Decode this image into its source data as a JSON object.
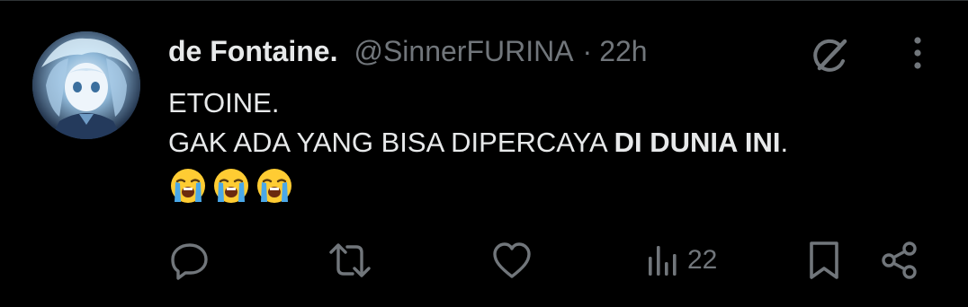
{
  "tweet": {
    "display_name": "de Fontaine.",
    "handle": "@SinnerFURINA",
    "separator": "·",
    "time": "22h",
    "text_line1": "ETOINE.",
    "text_line2_normal": "GAK ADA YANG BISA DIPERCAYA ",
    "text_line2_bold": "DI DUNIA INI",
    "text_line2_end": ".",
    "emojis": [
      "loudly-crying-face",
      "loudly-crying-face",
      "loudly-crying-face"
    ]
  },
  "actions": {
    "views_count": "22"
  },
  "icons": {
    "grok": "grok-icon",
    "more": "more-icon",
    "reply": "reply-icon",
    "repost": "repost-icon",
    "like": "like-icon",
    "views": "views-icon",
    "bookmark": "bookmark-icon",
    "share": "share-icon"
  },
  "colors": {
    "background": "#000000",
    "text_primary": "#e7e9ea",
    "text_secondary": "#71767b"
  }
}
